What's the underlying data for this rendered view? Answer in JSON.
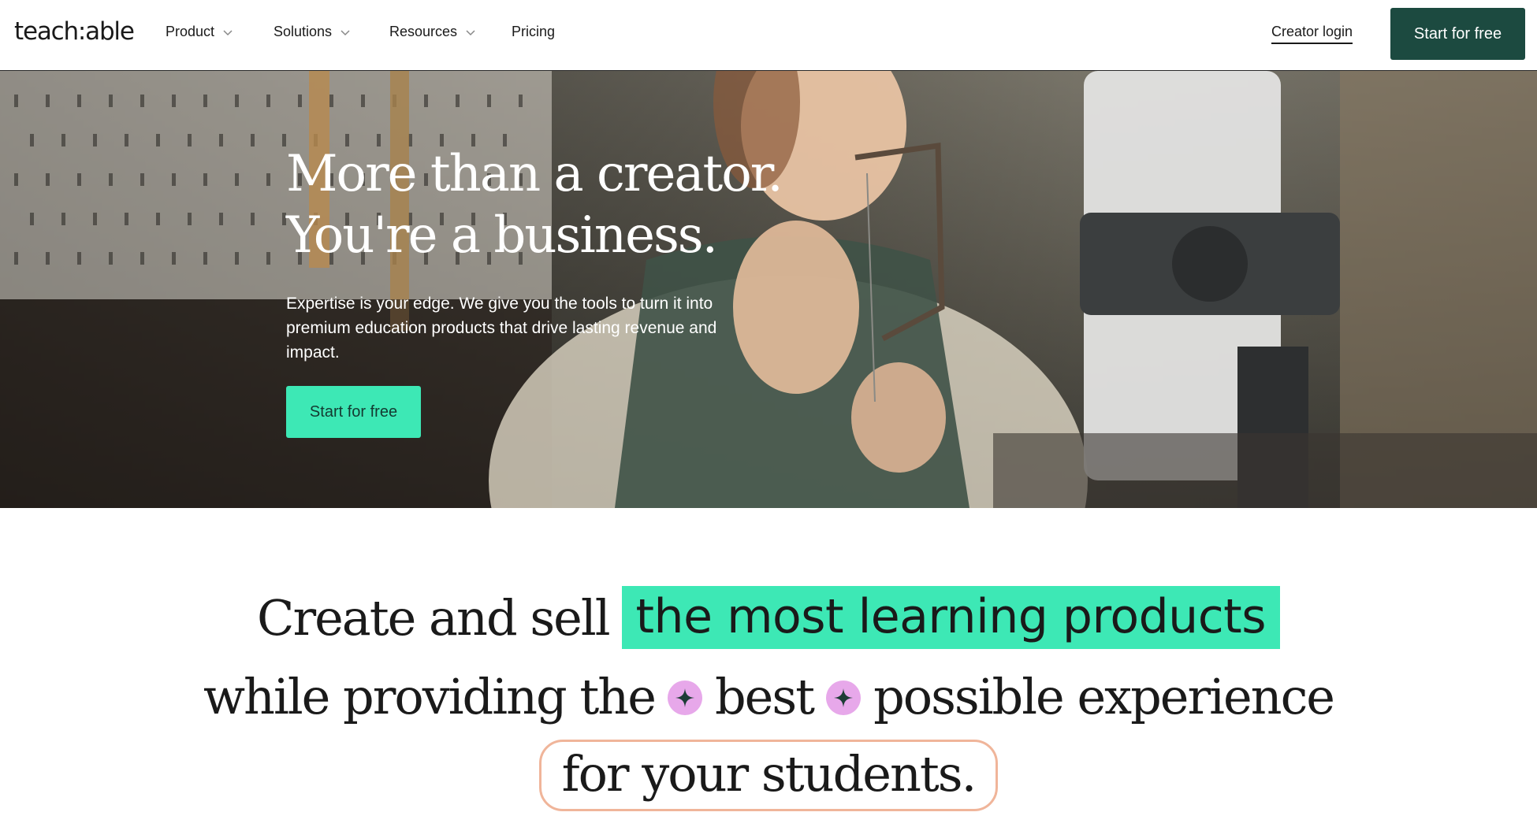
{
  "nav": {
    "logo": "teach:able",
    "items": [
      {
        "label": "Product",
        "has_dropdown": true
      },
      {
        "label": "Solutions",
        "has_dropdown": true
      },
      {
        "label": "Resources",
        "has_dropdown": true
      },
      {
        "label": "Pricing",
        "has_dropdown": false
      }
    ],
    "login_label": "Creator login",
    "cta_label": "Start for free"
  },
  "hero": {
    "title_line1": "More than a creator.",
    "title_line2": "You're a business.",
    "subtitle": "Expertise is your edge. We give you the tools to turn it into premium education products that drive lasting revenue and impact.",
    "cta_label": "Start for free"
  },
  "headline": {
    "part1": "Create and sell",
    "highlight": "the most learning products",
    "part2": "while providing the",
    "part3": "best",
    "part4": "possible experience",
    "part5": "for your students."
  },
  "colors": {
    "brand_dark": "#1c4a40",
    "brand_teal": "#3de8b5",
    "sparkle_pink": "#e7a8ea",
    "pill_outline": "#f0b59a"
  }
}
